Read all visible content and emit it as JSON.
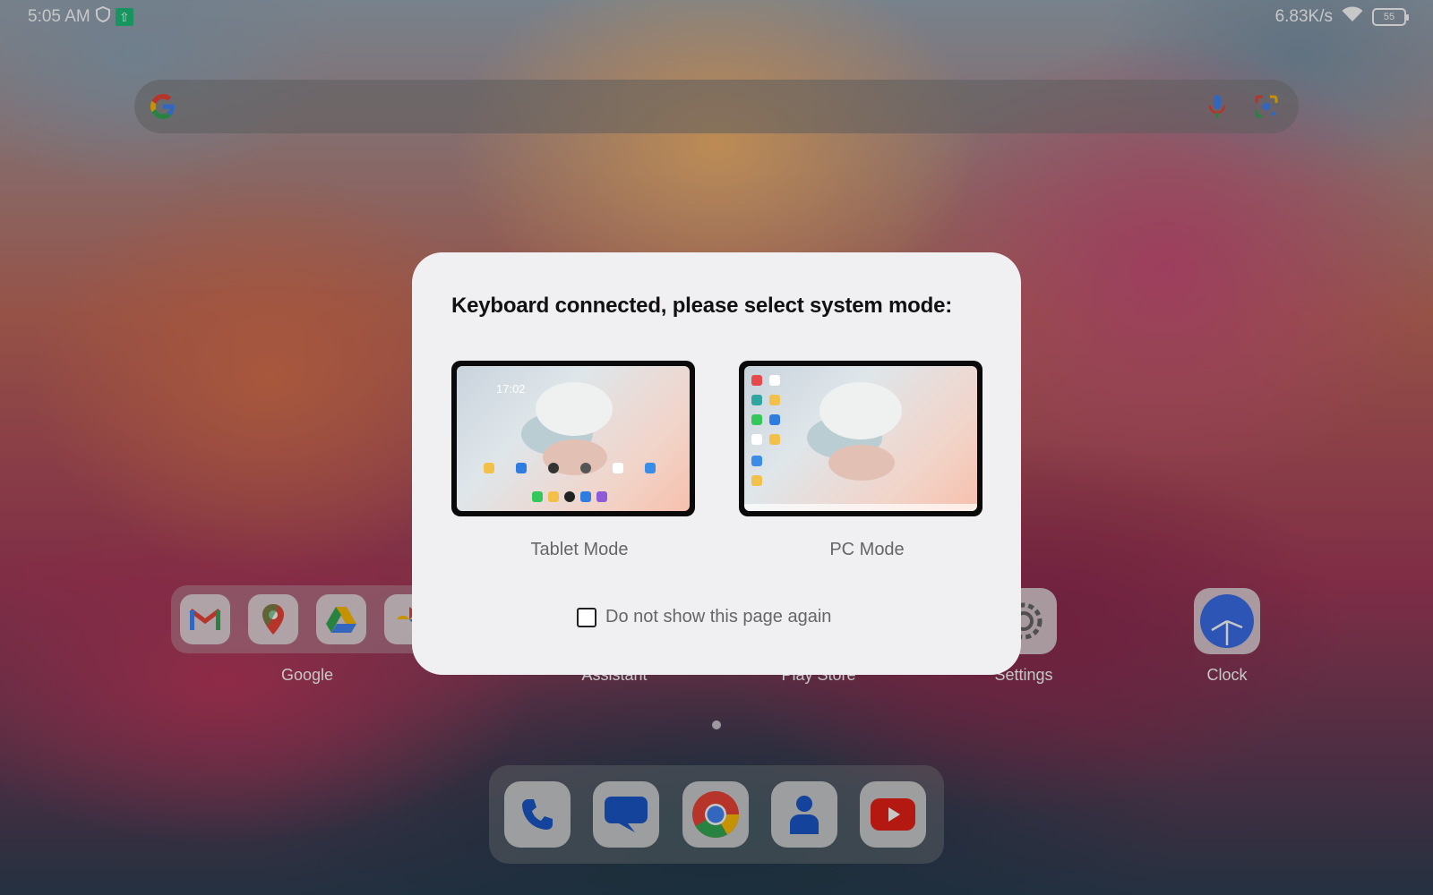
{
  "status_bar": {
    "time": "5:05 AM",
    "net_speed": "6.83K/s",
    "battery": "55",
    "icons": [
      "vpn-shield-icon",
      "upload-icon",
      "wifi-icon",
      "battery-icon"
    ]
  },
  "search_bar": {
    "logo": "google-g-icon",
    "icons": [
      "mic-icon",
      "lens-icon"
    ]
  },
  "home": {
    "labels": [
      "Google",
      "Assistant",
      "Play Store",
      "Settings",
      "Clock"
    ],
    "folder_apps": [
      "gmail-icon",
      "maps-icon",
      "drive-icon",
      "photos-icon"
    ],
    "dock_apps": [
      "phone-icon",
      "messages-icon",
      "chrome-icon",
      "contacts-icon",
      "youtube-icon"
    ]
  },
  "dialog": {
    "title": "Keyboard connected, please select system mode:",
    "tablet_mode_label": "Tablet Mode",
    "pc_mode_label": "PC Mode",
    "tablet_preview_clock": "17:02",
    "checkbox_label": "Do not show this page again",
    "checkbox_checked": false
  },
  "colors": {
    "dialog_bg": "#f0eff2",
    "accent_green": "#1fbf7a"
  }
}
